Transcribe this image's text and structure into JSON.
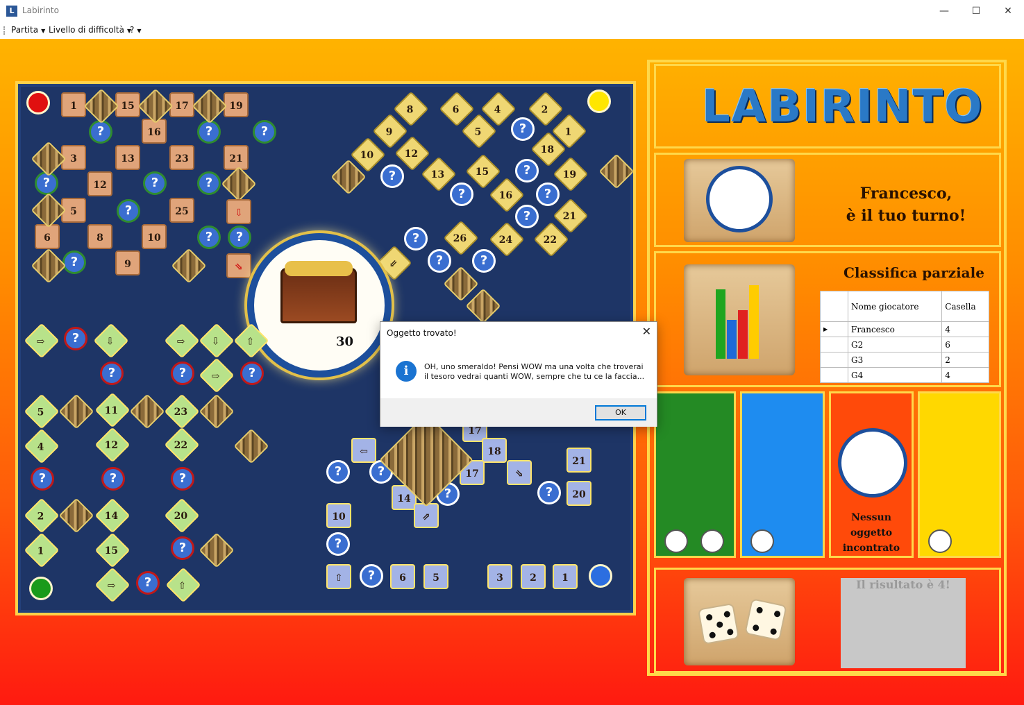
{
  "window": {
    "title": "Labirinto",
    "app_icon_letter": "L",
    "minimize_glyph": "—",
    "maximize_glyph": "☐",
    "close_glyph": "✕"
  },
  "menu": {
    "items": [
      "Partita",
      "Livello di difficoltà",
      "?"
    ]
  },
  "board": {
    "red_path_numbers": [
      "1",
      "15",
      "17",
      "19",
      "16",
      "3",
      "13",
      "23",
      "21",
      "12",
      "5",
      "25",
      "6",
      "8",
      "10",
      "9"
    ],
    "yellow_path_numbers": [
      "8",
      "6",
      "4",
      "2",
      "9",
      "5",
      "1",
      "10",
      "12",
      "18",
      "13",
      "15",
      "19",
      "16",
      "21",
      "26",
      "24",
      "22"
    ],
    "green_path_numbers": [
      "5",
      "11",
      "23",
      "4",
      "12",
      "22",
      "2",
      "14",
      "20",
      "1",
      "15"
    ],
    "blue_path_numbers": [
      "17",
      "18",
      "17",
      "21",
      "14",
      "20",
      "10",
      "6",
      "5",
      "3",
      "2",
      "1"
    ],
    "treasure_value": "30",
    "question_mark": "?"
  },
  "side": {
    "logo_text": "LABIRINTO",
    "turn_message_line1": "Francesco,",
    "turn_message_line2": "è il tuo turno!",
    "ranking": {
      "title": "Classifica parziale",
      "headers": [
        "Nome giocatore",
        "Casella"
      ],
      "rows": [
        {
          "name": "Francesco",
          "cell": "4"
        },
        {
          "name": "G2",
          "cell": "6"
        },
        {
          "name": "G3",
          "cell": "2"
        },
        {
          "name": "G4",
          "cell": "4"
        }
      ]
    },
    "player_colors": [
      "#248a24",
      "#1e8cf0",
      "#ff4a0a",
      "#ffd800"
    ],
    "no_item_text": "Nessun oggetto incontrato",
    "dice_result": "Il risultato è 4!"
  },
  "dialog": {
    "title": "Oggetto trovato!",
    "icon_letter": "i",
    "message": "OH, uno smeraldo! Pensi WOW ma una volta che troverai il tesoro vedrai quanti WOW, sempre che tu ce la faccia...",
    "ok_label": "OK",
    "close_glyph": "✕"
  }
}
